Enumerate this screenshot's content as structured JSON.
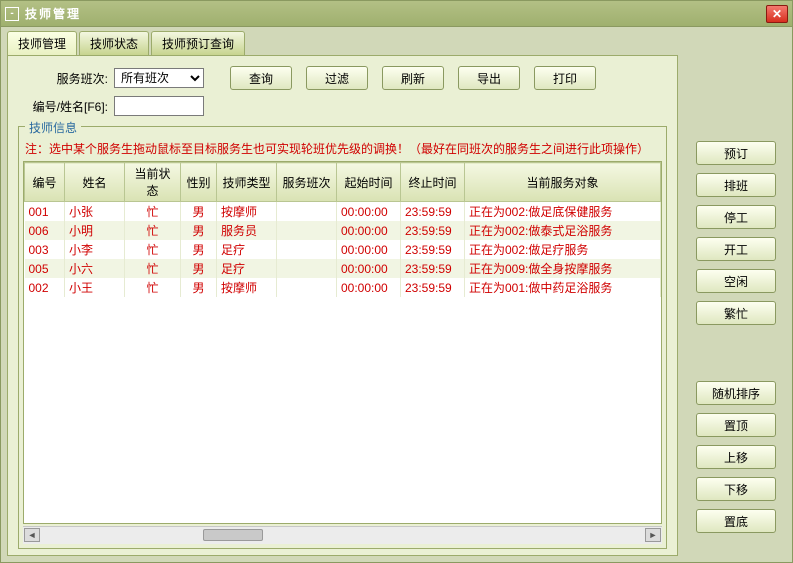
{
  "window": {
    "title": "技师管理"
  },
  "tabs": [
    {
      "label": "技师管理",
      "active": true
    },
    {
      "label": "技师状态",
      "active": false
    },
    {
      "label": "技师预订查询",
      "active": false
    }
  ],
  "filters": {
    "shift_label": "服务班次:",
    "shift_value": "所有班次",
    "idname_label": "编号/姓名[F6]:",
    "idname_value": ""
  },
  "top_buttons": {
    "query": "查询",
    "filter": "过滤",
    "refresh": "刷新",
    "export": "导出",
    "print": "打印"
  },
  "fieldset": {
    "legend": "技师信息",
    "note": "注：选中某个服务生拖动鼠标至目标服务生也可实现轮班优先级的调换！（最好在同班次的服务生之间进行此项操作）"
  },
  "columns": {
    "id": "编号",
    "name": "姓名",
    "state": "当前状态",
    "gender": "性别",
    "type": "技师类型",
    "shift": "服务班次",
    "start": "起始时间",
    "end": "终止时间",
    "target": "当前服务对象"
  },
  "rows": [
    {
      "id": "001",
      "name": "小张",
      "state": "忙",
      "gender": "男",
      "type": "按摩师",
      "shift": "",
      "start": "00:00:00",
      "end": "23:59:59",
      "target": "正在为002:做足底保健服务"
    },
    {
      "id": "006",
      "name": "小明",
      "state": "忙",
      "gender": "男",
      "type": "服务员",
      "shift": "",
      "start": "00:00:00",
      "end": "23:59:59",
      "target": "正在为002:做泰式足浴服务"
    },
    {
      "id": "003",
      "name": "小李",
      "state": "忙",
      "gender": "男",
      "type": "足疗",
      "shift": "",
      "start": "00:00:00",
      "end": "23:59:59",
      "target": "正在为002:做足疗服务"
    },
    {
      "id": "005",
      "name": "小六",
      "state": "忙",
      "gender": "男",
      "type": "足疗",
      "shift": "",
      "start": "00:00:00",
      "end": "23:59:59",
      "target": "正在为009:做全身按摩服务"
    },
    {
      "id": "002",
      "name": "小王",
      "state": "忙",
      "gender": "男",
      "type": "按摩师",
      "shift": "",
      "start": "00:00:00",
      "end": "23:59:59",
      "target": "正在为001:做中药足浴服务"
    }
  ],
  "side_buttons": {
    "reserve": "预订",
    "schedule": "排班",
    "stop": "停工",
    "start": "开工",
    "idle": "空闲",
    "busy": "繁忙",
    "shuffle": "随机排序",
    "top": "置顶",
    "up": "上移",
    "down": "下移",
    "bottom": "置底"
  }
}
